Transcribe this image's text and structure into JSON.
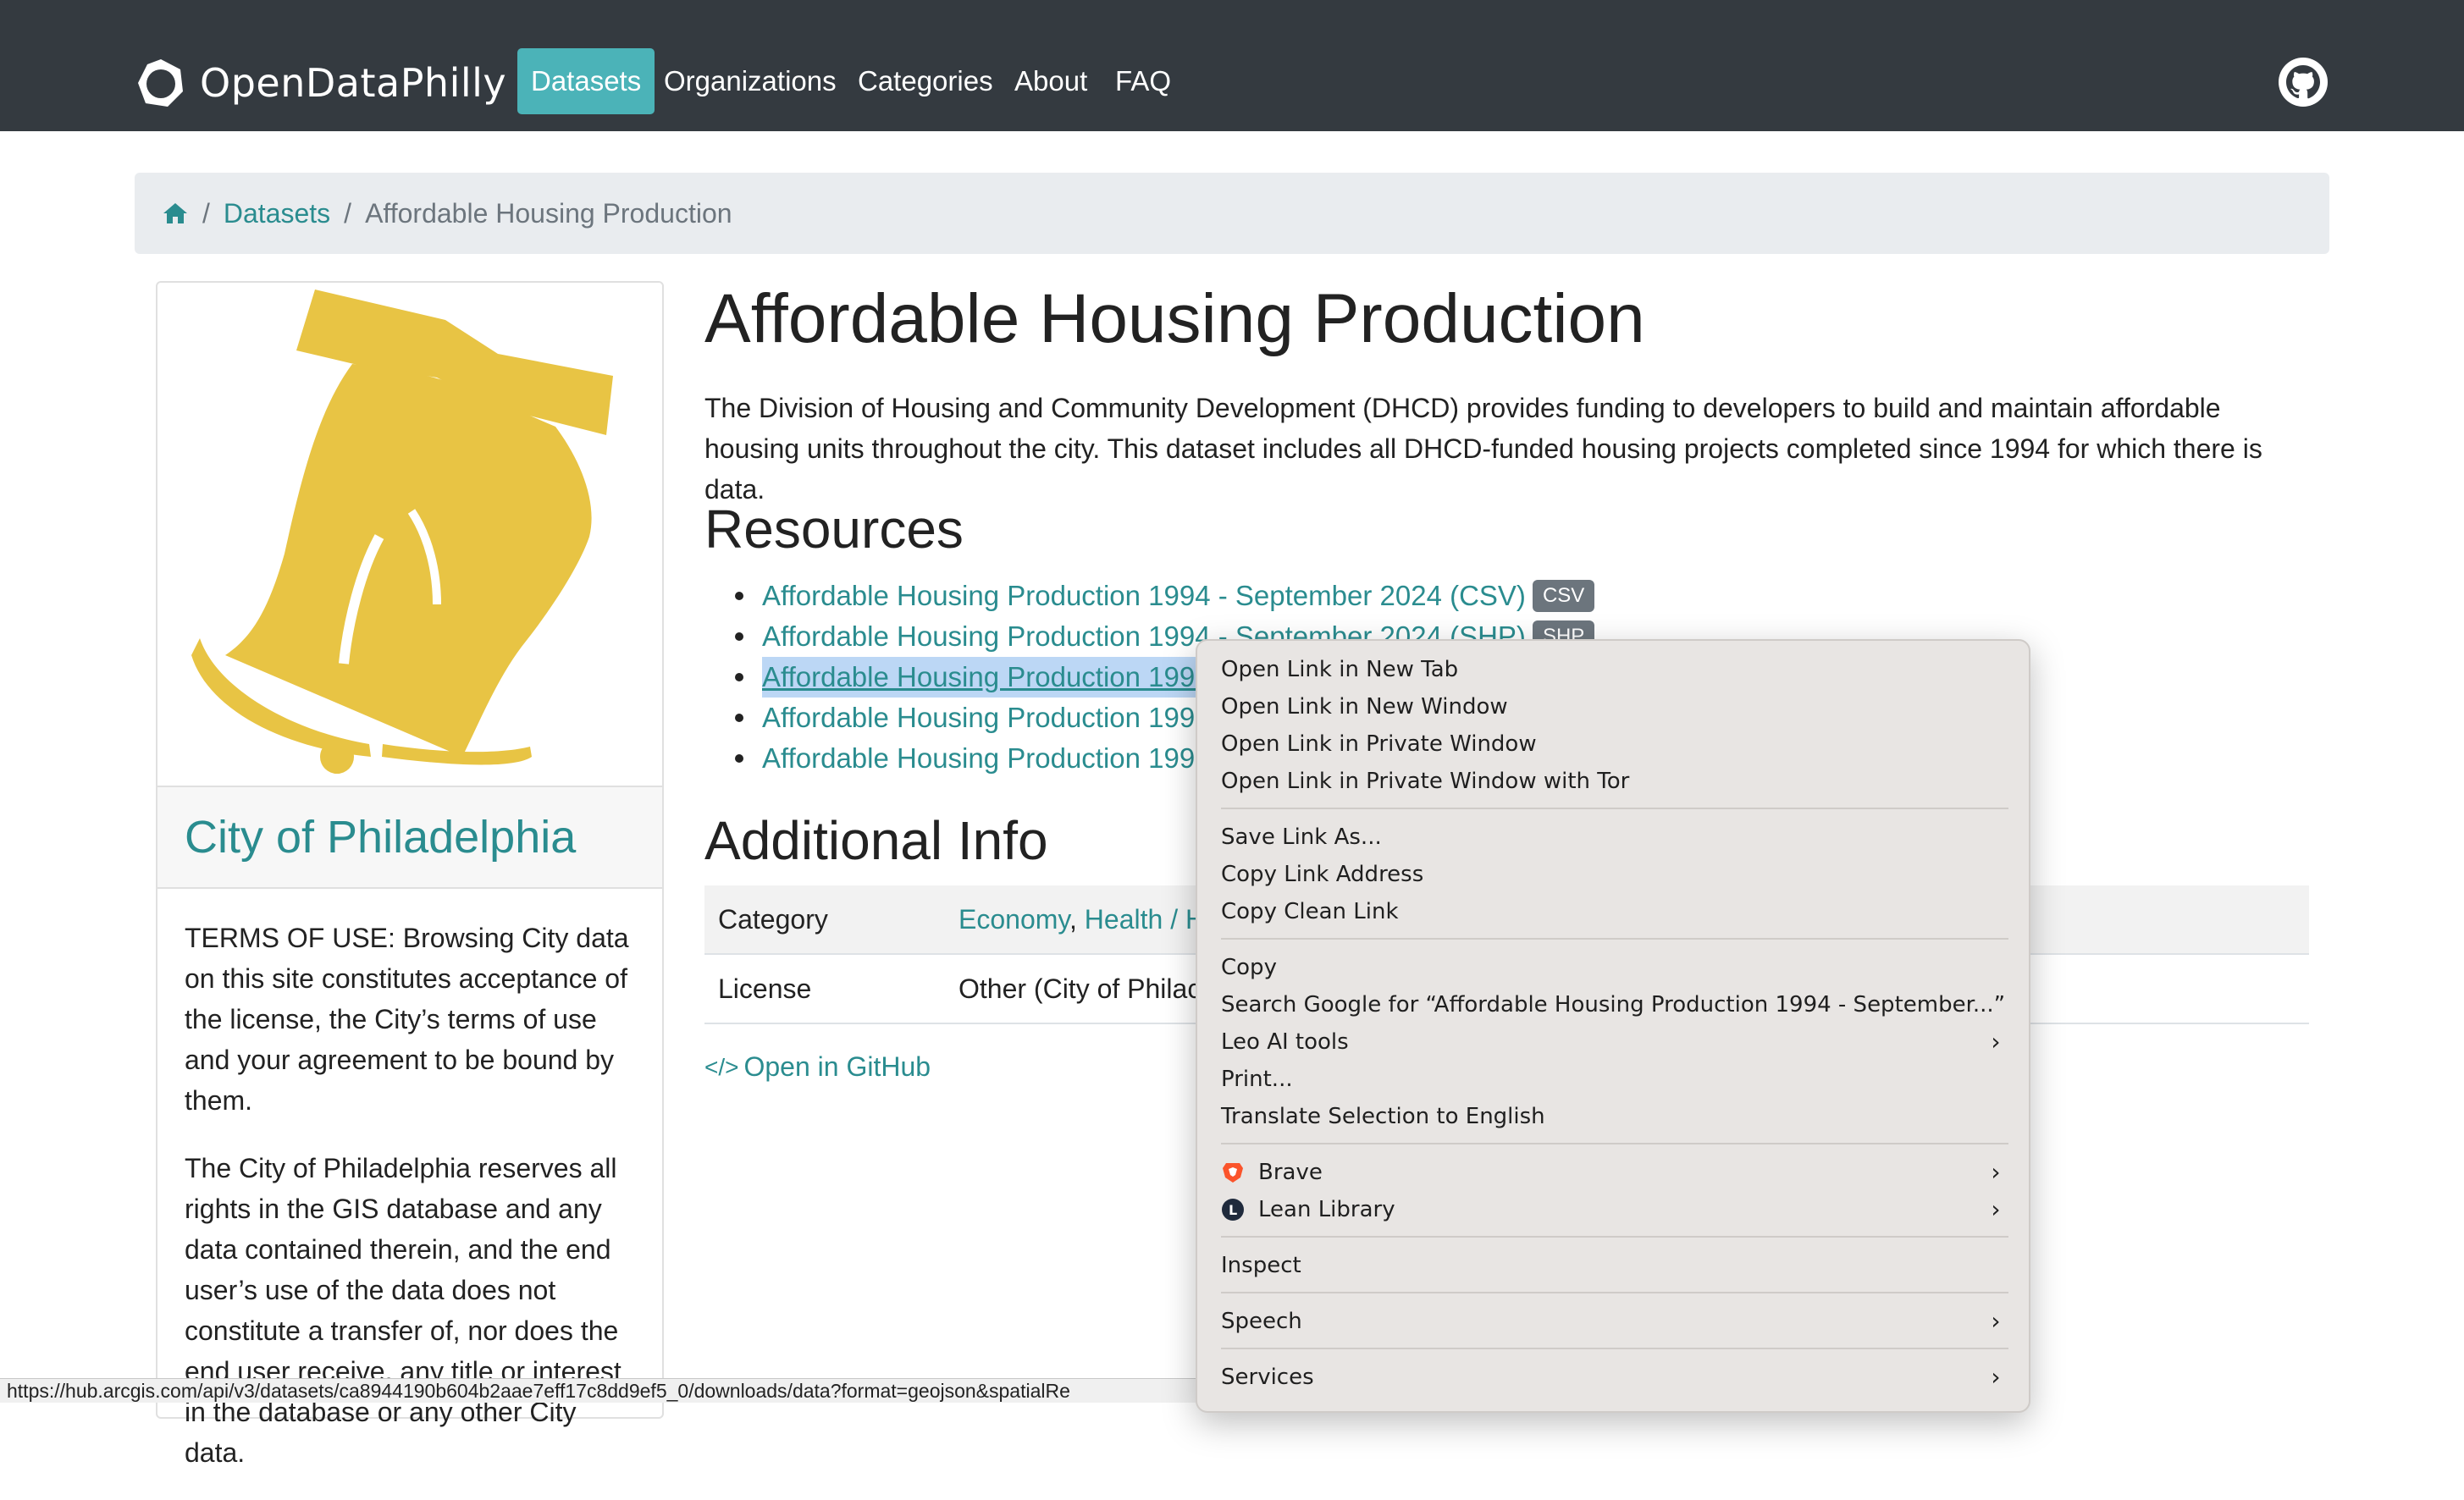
{
  "nav": {
    "brand": "OpenDataPhilly",
    "items": [
      "Datasets",
      "Organizations",
      "Categories",
      "About",
      "FAQ"
    ],
    "active": "Datasets",
    "github_icon": "github-icon"
  },
  "breadcrumb": {
    "home_icon": "home-icon",
    "datasets": "Datasets",
    "current": "Affordable Housing Production"
  },
  "sidebar": {
    "logo": "liberty-bell-logo",
    "organization": "City of Philadelphia",
    "terms": "TERMS OF USE: Browsing City data on this site constitutes acceptance of the license, the City’s terms of use and your agreement to be bound by them.",
    "rights": "The City of Philadelphia reserves all rights in the GIS database and any data contained therein, and the end user’s use of the data does not constitute a transfer of, nor does the end user receive, any title or interest in the database or any other City data."
  },
  "main": {
    "title": "Affordable Housing Production",
    "description": "The Division of Housing and Community Development (DHCD) provides funding to developers to build and maintain affordable housing units throughout the city. This dataset includes all DHCD-funded housing projects completed since 1994 for which there is data.",
    "resources_heading": "Resources",
    "resources": [
      {
        "label": "Affordable Housing Production 1994 - September 2024 (CSV)",
        "badge": "CSV"
      },
      {
        "label": "Affordable Housing Production 1994 - September 2024 (SHP)",
        "badge": "SHP"
      },
      {
        "label": "Affordable Housing Production 1994",
        "badge": ""
      },
      {
        "label": "Affordable Housing Production 1994",
        "badge": ""
      },
      {
        "label": "Affordable Housing Production 1994",
        "badge": ""
      }
    ],
    "additional_heading": "Additional Info",
    "info": {
      "category_key": "Category",
      "category_values": [
        "Economy",
        "Health / H"
      ],
      "license_key": "License",
      "license_value": "Other (City of Philac"
    },
    "github_link": "Open in GitHub"
  },
  "status_bar": "https://hub.arcgis.com/api/v3/datasets/ca8944190b604b2aae7eff17c8dd9ef5_0/downloads/data?format=geojson&spatialRe",
  "context_menu": {
    "groups": [
      [
        {
          "label": "Open Link in New Tab"
        },
        {
          "label": "Open Link in New Window"
        },
        {
          "label": "Open Link in Private Window"
        },
        {
          "label": "Open Link in Private Window with Tor"
        }
      ],
      [
        {
          "label": "Save Link As..."
        },
        {
          "label": "Copy Link Address"
        },
        {
          "label": "Copy Clean Link"
        }
      ],
      [
        {
          "label": "Copy"
        },
        {
          "label": "Search Google for “Affordable Housing Production 1994 - September...”"
        },
        {
          "label": "Leo AI tools",
          "submenu": true
        },
        {
          "label": "Print..."
        },
        {
          "label": "Translate Selection to English"
        }
      ],
      [
        {
          "label": "Brave",
          "icon": "brave-lion-icon",
          "submenu": true
        },
        {
          "label": "Lean Library",
          "icon": "lean-library-icon",
          "submenu": true
        }
      ],
      [
        {
          "label": "Inspect"
        }
      ],
      [
        {
          "label": "Speech",
          "submenu": true
        }
      ],
      [
        {
          "label": "Services",
          "submenu": true
        }
      ]
    ],
    "colors": {
      "background": "#e8e5e3",
      "separator": "#cfcbc8"
    }
  },
  "colors": {
    "navbar": "#343a40",
    "accent": "#4bb3b8",
    "link": "#2a8c8f",
    "bell": "#e8c444"
  }
}
